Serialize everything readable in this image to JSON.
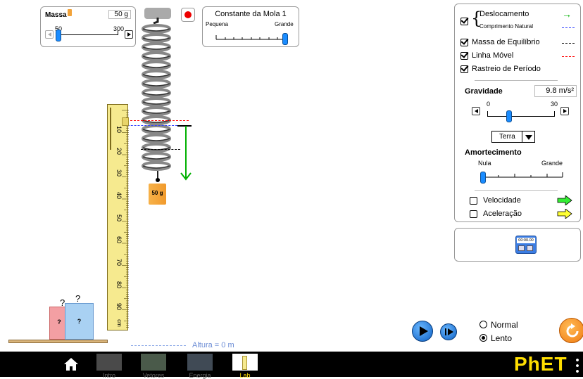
{
  "mass_panel": {
    "title": "Massa",
    "value_readout": "50 g",
    "min_label": "50",
    "max_label": "300",
    "value_grams": 50
  },
  "spring_panel": {
    "title": "Constante da Mola 1",
    "left_label": "Pequena",
    "right_label": "Grande",
    "level_fraction": 1.0
  },
  "weight_label": "50 g",
  "ruler_labels": [
    "10",
    "20",
    "30",
    "40",
    "50",
    "60",
    "70",
    "80",
    "90",
    "cm"
  ],
  "mystery_labels": {
    "q1": "?",
    "q2": "?",
    "box1": "?",
    "box2": "?"
  },
  "height_label": "Altura = 0 m",
  "controls": {
    "checkboxes": [
      {
        "label": "Deslocamento",
        "checked": true,
        "color": "#00b000"
      },
      {
        "label": "Comprimento Natural",
        "checked": true,
        "color": "#3344ff"
      },
      {
        "label": "Massa de Equilíbrio",
        "checked": true,
        "color": "#000000"
      },
      {
        "label": "Linha Móvel",
        "checked": true,
        "color": "#ff0000"
      },
      {
        "label": "Rastreio de Período",
        "checked": true
      }
    ],
    "gravity": {
      "title": "Gravidade",
      "readout": "9.8 m/s²",
      "min_label": "0",
      "max_label": "30",
      "value": 9.8,
      "planet_select": "Terra"
    },
    "damping": {
      "title": "Amortecimento",
      "left_label": "Nula",
      "right_label": "Grande",
      "value_fraction": 0.0
    },
    "velocity": {
      "label": "Velocidade",
      "checked": false,
      "arrow_color": "#33ee33"
    },
    "acceleration": {
      "label": "Aceleração",
      "checked": false,
      "arrow_color": "#ffff33"
    }
  },
  "stopwatch_time": "00:00.00",
  "playback": {
    "speed_normal": "Normal",
    "speed_slow": "Lento",
    "selected": "Lento"
  },
  "nav": {
    "tabs": [
      "Intro",
      "Vetores",
      "Energia",
      "Lab"
    ],
    "selected": "Lab",
    "brand": "PhET"
  }
}
